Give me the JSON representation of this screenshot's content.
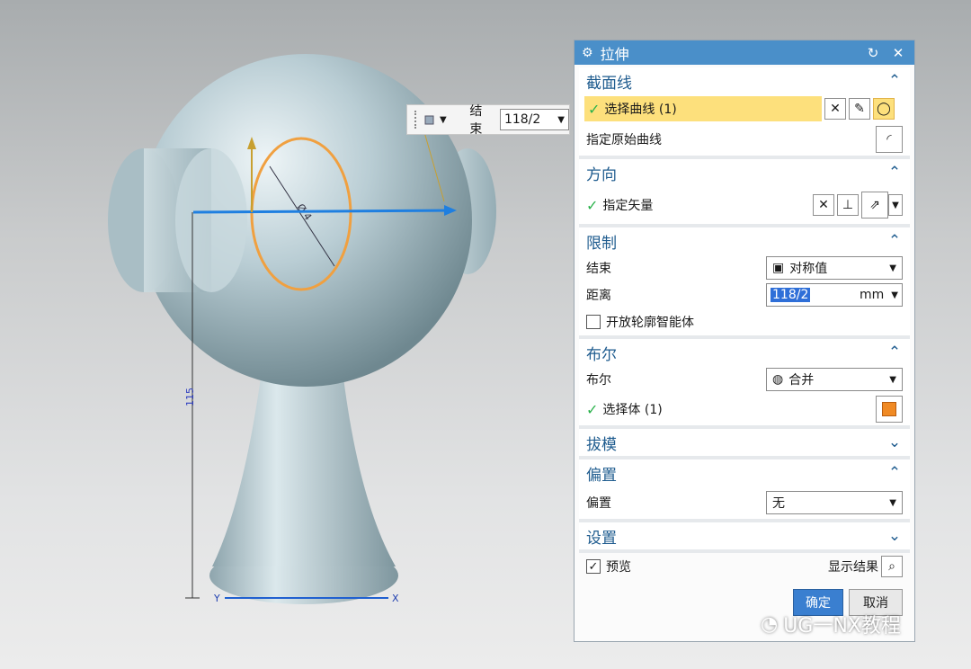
{
  "viewport": {
    "dimension_diameter_label": "Ø 4",
    "dimension_height_label": "115",
    "axis_y": "Y",
    "axis_x": "X"
  },
  "mini_toolbar": {
    "label": "结束",
    "value": "118/2"
  },
  "dialog": {
    "title": "拉伸",
    "sections": {
      "section_curve": {
        "header": "截面线",
        "select_curve": "选择曲线 (1)",
        "specify_origin": "指定原始曲线"
      },
      "direction": {
        "header": "方向",
        "specify_vector": "指定矢量"
      },
      "limits": {
        "header": "限制",
        "end_label": "结束",
        "end_value": "对称值",
        "distance_label": "距离",
        "distance_value": "118/2",
        "distance_unit": "mm",
        "open_profile": "开放轮廓智能体"
      },
      "boolean": {
        "header": "布尔",
        "bool_label": "布尔",
        "bool_value": "合并",
        "select_body": "选择体 (1)"
      },
      "draft": {
        "header": "拔模"
      },
      "offset": {
        "header": "偏置",
        "offset_label": "偏置",
        "offset_value": "无"
      },
      "settings": {
        "header": "设置"
      }
    },
    "footer": {
      "preview": "预览",
      "show_result": "显示结果",
      "ok": "确定",
      "cancel": "取消"
    }
  },
  "watermark": "UG一NX教程",
  "colors": {
    "title_bar": "#4a8fc9",
    "section_header": "#1f5c8f",
    "highlight": "#fde07c",
    "model": "#b9cdd4",
    "sketch": "#f0a040",
    "vector": "#1f7fe0"
  }
}
